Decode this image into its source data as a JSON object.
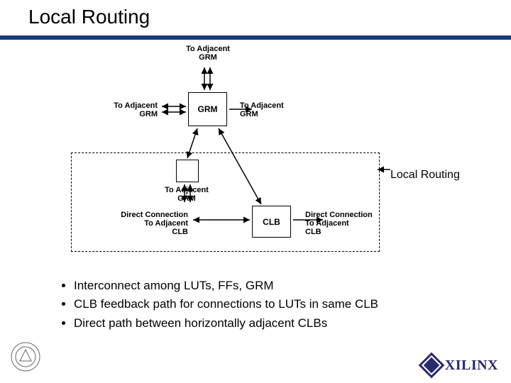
{
  "title": "Local Routing",
  "routing_label": "Local Routing",
  "diagram": {
    "grm_center": "GRM",
    "clb_label": "CLB",
    "adj_top": "To Adjacent\nGRM",
    "adj_left": "To Adjacent\nGRM",
    "adj_right": "To Adjacent\nGRM",
    "adj_bottom": "To Adjacent\nGRM",
    "direct_left": "Direct Connection\nTo Adjacent\nCLB",
    "direct_right": "Direct Connection\nTo Adjacent\nCLB"
  },
  "bullets": [
    "Interconnect among LUTs, FFs, GRM",
    "CLB feedback path for connections to LUTs in same CLB",
    "Direct path between horizontally adjacent CLBs"
  ],
  "footer": {
    "logo_text": "XILINX"
  }
}
